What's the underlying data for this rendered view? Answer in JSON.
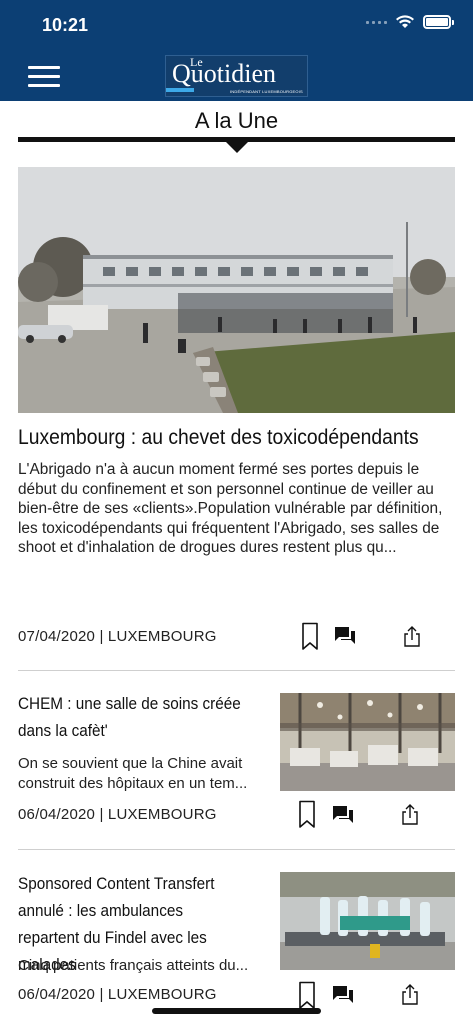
{
  "status_bar": {
    "time": "10:21"
  },
  "header": {
    "logo_le": "Le",
    "logo_name": "Quotidien",
    "logo_tag": "INDÉPENDANT LUXEMBOURGEOIS"
  },
  "section": {
    "title": "A la Une"
  },
  "hero": {
    "title": "Luxembourg : au chevet des toxicodépendants",
    "summary": "L'Abrigado n'a à aucun moment fermé ses portes depuis le début du confinement et son personnel continue de veiller au bien-être de ses «clients».Population vulnérable par définition, les toxicodépendants qui fréquentent l'Abrigado, ses salles de shoot et d'inhalation de drogues dures restent plus qu...",
    "meta": "07/04/2020 | LUXEMBOURG"
  },
  "articles": [
    {
      "title": "CHEM : une salle de soins créée dans la cafèt'",
      "summary": "On se souvient que la Chine avait construit des hôpitaux en un tem...",
      "meta": "06/04/2020 | LUXEMBOURG"
    },
    {
      "title": "Sponsored Content Transfert annulé : les ambulances repartent du Findel avec les malades",
      "summary": "Cinq patients français atteints du...",
      "meta": "06/04/2020 | LUXEMBOURG"
    }
  ],
  "icons": {
    "bookmark": "bookmark-icon",
    "comments": "comments-icon",
    "share": "share-icon",
    "menu": "hamburger-menu-icon"
  },
  "colors": {
    "header_bg": "#0c3f74",
    "accent": "#3da9e8"
  }
}
